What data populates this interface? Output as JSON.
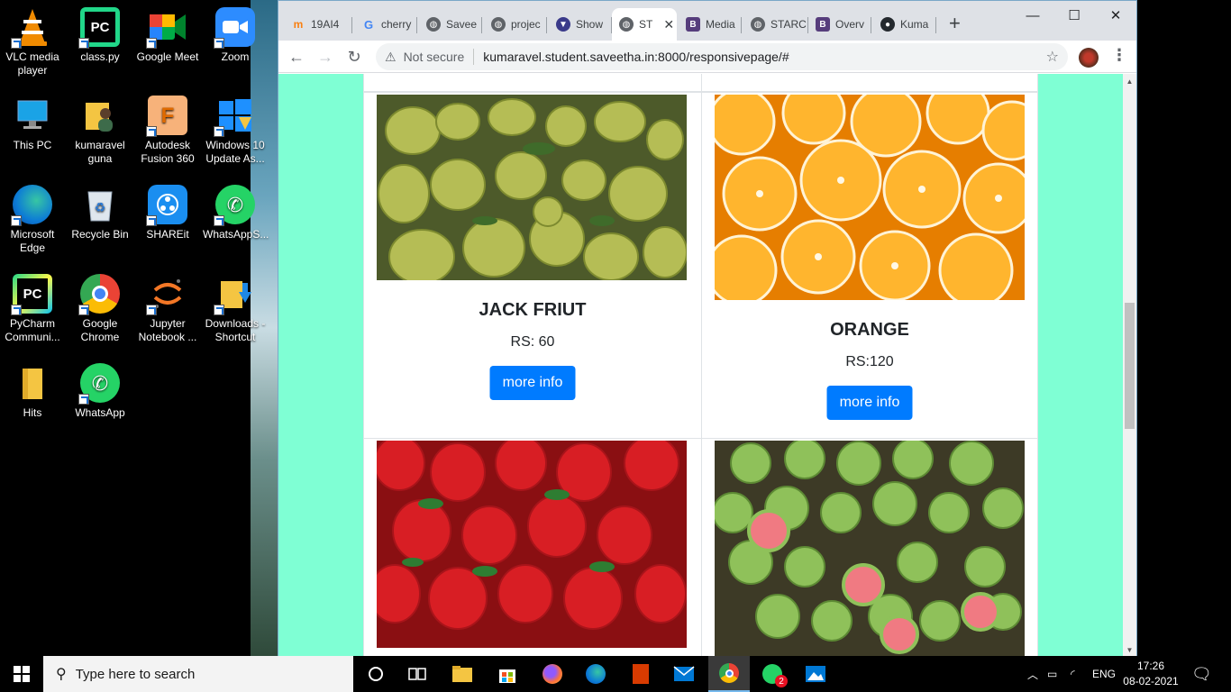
{
  "desktop": {
    "icons": [
      {
        "label": "VLC media player"
      },
      {
        "label": "class.py"
      },
      {
        "label": "Google Meet"
      },
      {
        "label": "Zoom"
      },
      {
        "label": "This PC"
      },
      {
        "label": "kumaravel guna"
      },
      {
        "label": "Autodesk Fusion 360"
      },
      {
        "label": "Windows 10 Update As..."
      },
      {
        "label": "Microsoft Edge"
      },
      {
        "label": "Recycle Bin"
      },
      {
        "label": "SHAREit"
      },
      {
        "label": "WhatsAppS..."
      },
      {
        "label": "PyCharm Communi..."
      },
      {
        "label": "Google Chrome"
      },
      {
        "label": "Jupyter Notebook ..."
      },
      {
        "label": "Downloads - Shortcut"
      },
      {
        "label": "Hits"
      },
      {
        "label": "WhatsApp"
      }
    ]
  },
  "browser": {
    "tabs": [
      {
        "label": "19AI4",
        "favicon": "moodle-icon"
      },
      {
        "label": "cherry",
        "favicon": "google-icon"
      },
      {
        "label": "Savee",
        "favicon": "globe-icon"
      },
      {
        "label": "projec",
        "favicon": "globe-icon"
      },
      {
        "label": "Show",
        "favicon": "shield-icon"
      },
      {
        "label": "ST",
        "favicon": "globe-icon",
        "active": true
      },
      {
        "label": "Media",
        "favicon": "bootstrap-icon"
      },
      {
        "label": "STARC",
        "favicon": "globe-icon"
      },
      {
        "label": "Overv",
        "favicon": "bootstrap-icon"
      },
      {
        "label": "Kuma",
        "favicon": "github-icon"
      }
    ],
    "new_tab": "+",
    "address": {
      "security": "Not secure",
      "url": "kumaravel.student.saveetha.in:8000/responsivepage/#"
    }
  },
  "page": {
    "cards": [
      {
        "title": "JACK FRIUT",
        "price": "RS: 60",
        "button": "more info"
      },
      {
        "title": "ORANGE",
        "price": "RS:120",
        "button": "more info"
      },
      {
        "title": "",
        "price": "",
        "button": ""
      },
      {
        "title": "",
        "price": "",
        "button": ""
      }
    ],
    "background_color": "#7fffd4",
    "button_color": "#007bff"
  },
  "taskbar": {
    "search_placeholder": "Type here to search",
    "language": "ENG",
    "time": "17:26",
    "date": "08-02-2021",
    "whatsapp_badge": "2"
  }
}
